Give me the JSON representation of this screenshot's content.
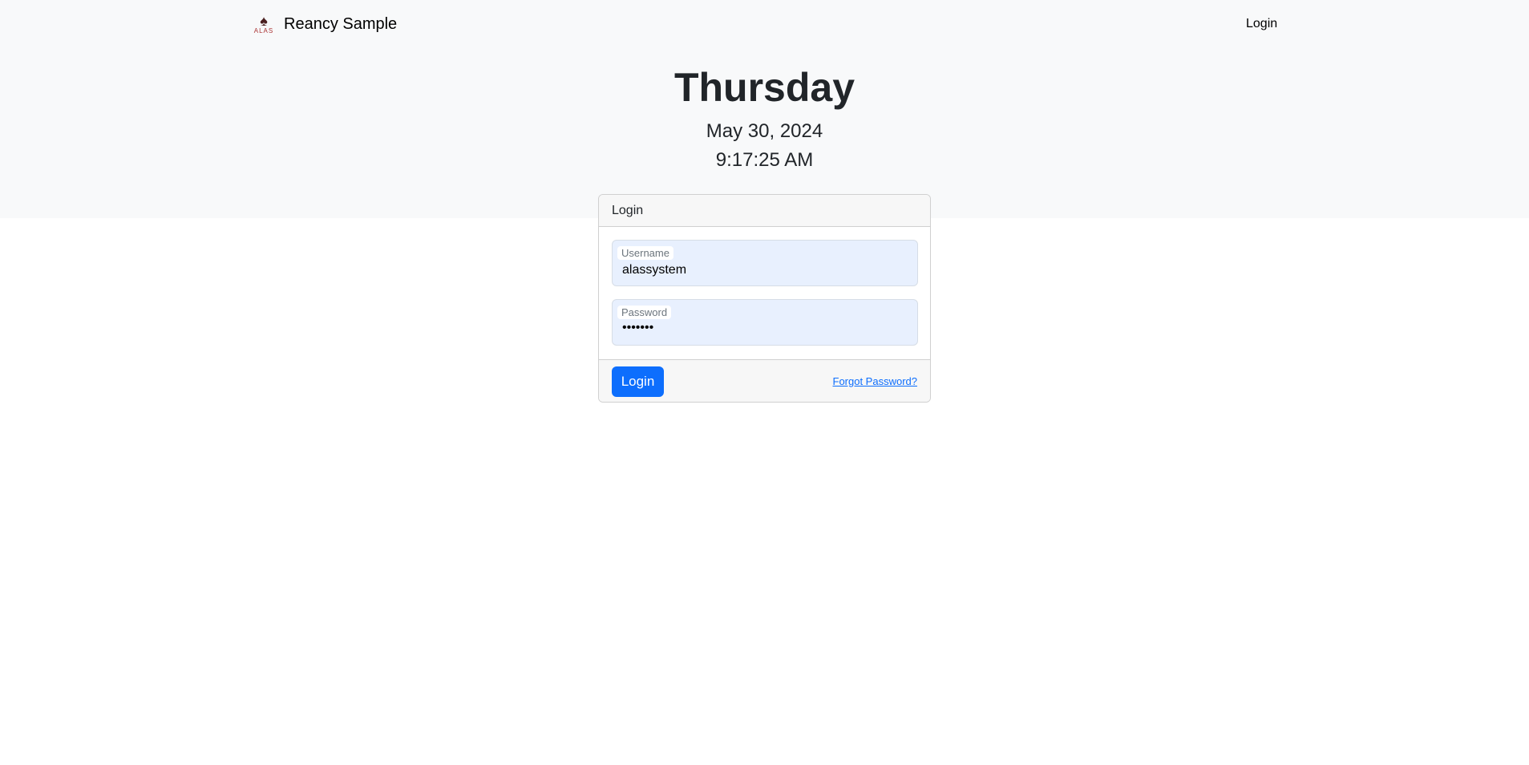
{
  "nav": {
    "brand": "Reancy Sample",
    "logo_text": "ALAS",
    "login": "Login"
  },
  "hero": {
    "day": "Thursday",
    "date": "May 30, 2024",
    "time": "9:17:25 AM"
  },
  "card": {
    "title": "Login",
    "username": {
      "label": "Username",
      "value": "alassystem"
    },
    "password": {
      "label": "Password",
      "value": "•••••••"
    },
    "login_button": "Login",
    "forgot_link": "Forgot Password?"
  },
  "colors": {
    "primary": "#0d6efd",
    "hero_bg": "#f8f9fa",
    "input_bg": "#e8f0fe"
  }
}
